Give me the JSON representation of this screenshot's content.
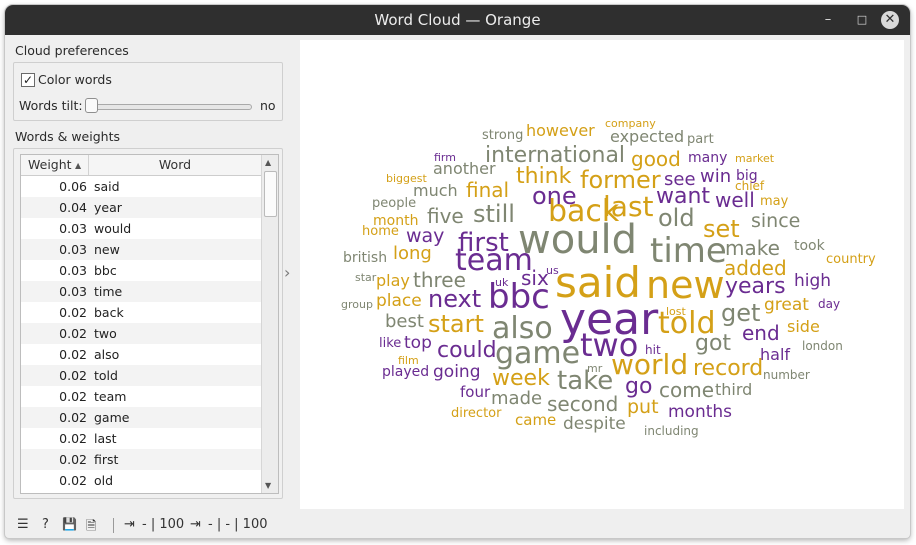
{
  "window": {
    "title": "Word Cloud — Orange",
    "minimize": "–",
    "maximize": "□",
    "close": "✕"
  },
  "preferences": {
    "title": "Cloud preferences",
    "color_words_label": "Color words",
    "color_words_checked": true,
    "check_glyph": "✓",
    "words_tilt_label": "Words tilt:",
    "words_tilt_value": "no",
    "words_tilt_level": 0
  },
  "weights": {
    "title": "Words & weights",
    "columns": [
      "Weight",
      "Word"
    ],
    "sort_indicator": "▲",
    "scroll_up": "▲",
    "scroll_down": "▼",
    "rows": [
      {
        "weight": "0.06",
        "word": "said"
      },
      {
        "weight": "0.04",
        "word": "year"
      },
      {
        "weight": "0.03",
        "word": "would"
      },
      {
        "weight": "0.03",
        "word": "new"
      },
      {
        "weight": "0.03",
        "word": "bbc"
      },
      {
        "weight": "0.03",
        "word": "time"
      },
      {
        "weight": "0.02",
        "word": "back"
      },
      {
        "weight": "0.02",
        "word": "two"
      },
      {
        "weight": "0.02",
        "word": "also"
      },
      {
        "weight": "0.02",
        "word": "told"
      },
      {
        "weight": "0.02",
        "word": "team"
      },
      {
        "weight": "0.02",
        "word": "game"
      },
      {
        "weight": "0.02",
        "word": "last"
      },
      {
        "weight": "0.02",
        "word": "first"
      },
      {
        "weight": "0.02",
        "word": "old"
      }
    ]
  },
  "splitter_glyph": "›",
  "colors": {
    "purple": "#6a2c91",
    "gold": "#d4a017",
    "gray": "#7f8672"
  },
  "cloud_words": [
    {
      "text": "company",
      "color": "gold",
      "size": 11
    },
    {
      "text": "strong",
      "color": "gray",
      "size": 13
    },
    {
      "text": "however",
      "color": "gold",
      "size": 16
    },
    {
      "text": "expected",
      "color": "gray",
      "size": 16
    },
    {
      "text": "part",
      "color": "gray",
      "size": 13
    },
    {
      "text": "firm",
      "color": "purple",
      "size": 11
    },
    {
      "text": "international",
      "color": "gray",
      "size": 22
    },
    {
      "text": "good",
      "color": "gold",
      "size": 20
    },
    {
      "text": "many",
      "color": "purple",
      "size": 14
    },
    {
      "text": "market",
      "color": "gold",
      "size": 11
    },
    {
      "text": "another",
      "color": "gray",
      "size": 16
    },
    {
      "text": "biggest",
      "color": "gold",
      "size": 11
    },
    {
      "text": "think",
      "color": "gold",
      "size": 22
    },
    {
      "text": "former",
      "color": "gold",
      "size": 24
    },
    {
      "text": "see",
      "color": "purple",
      "size": 18
    },
    {
      "text": "win",
      "color": "purple",
      "size": 18
    },
    {
      "text": "big",
      "color": "purple",
      "size": 14
    },
    {
      "text": "much",
      "color": "gray",
      "size": 16
    },
    {
      "text": "final",
      "color": "gold",
      "size": 20
    },
    {
      "text": "one",
      "color": "purple",
      "size": 24
    },
    {
      "text": "want",
      "color": "purple",
      "size": 22
    },
    {
      "text": "chief",
      "color": "gold",
      "size": 12
    },
    {
      "text": "people",
      "color": "gray",
      "size": 13
    },
    {
      "text": "back",
      "color": "gold",
      "size": 30
    },
    {
      "text": "last",
      "color": "gold",
      "size": 28
    },
    {
      "text": "well",
      "color": "purple",
      "size": 20
    },
    {
      "text": "may",
      "color": "gold",
      "size": 13
    },
    {
      "text": "month",
      "color": "gold",
      "size": 14
    },
    {
      "text": "five",
      "color": "gray",
      "size": 20
    },
    {
      "text": "still",
      "color": "gray",
      "size": 24
    },
    {
      "text": "old",
      "color": "gray",
      "size": 24
    },
    {
      "text": "since",
      "color": "gray",
      "size": 19
    },
    {
      "text": "home",
      "color": "gold",
      "size": 13
    },
    {
      "text": "set",
      "color": "gold",
      "size": 24
    },
    {
      "text": "way",
      "color": "purple",
      "size": 19
    },
    {
      "text": "would",
      "color": "gray",
      "size": 40
    },
    {
      "text": "first",
      "color": "purple",
      "size": 26
    },
    {
      "text": "time",
      "color": "gray",
      "size": 34
    },
    {
      "text": "make",
      "color": "gray",
      "size": 20
    },
    {
      "text": "took",
      "color": "gray",
      "size": 14
    },
    {
      "text": "british",
      "color": "gray",
      "size": 14
    },
    {
      "text": "long",
      "color": "gold",
      "size": 18
    },
    {
      "text": "team",
      "color": "purple",
      "size": 30
    },
    {
      "text": "country",
      "color": "gold",
      "size": 13
    },
    {
      "text": "us",
      "color": "purple",
      "size": 11
    },
    {
      "text": "added",
      "color": "gold",
      "size": 20
    },
    {
      "text": "star",
      "color": "gray",
      "size": 11
    },
    {
      "text": "play",
      "color": "gold",
      "size": 16
    },
    {
      "text": "three",
      "color": "gray",
      "size": 20
    },
    {
      "text": "uk",
      "color": "purple",
      "size": 11
    },
    {
      "text": "six",
      "color": "purple",
      "size": 20
    },
    {
      "text": "said",
      "color": "gold",
      "size": 42
    },
    {
      "text": "new",
      "color": "gold",
      "size": 38
    },
    {
      "text": "years",
      "color": "purple",
      "size": 22
    },
    {
      "text": "high",
      "color": "purple",
      "size": 17
    },
    {
      "text": "next",
      "color": "purple",
      "size": 24
    },
    {
      "text": "bbc",
      "color": "purple",
      "size": 34
    },
    {
      "text": "group",
      "color": "gray",
      "size": 11
    },
    {
      "text": "place",
      "color": "gold",
      "size": 17
    },
    {
      "text": "great",
      "color": "gold",
      "size": 17
    },
    {
      "text": "day",
      "color": "purple",
      "size": 12
    },
    {
      "text": "lost",
      "color": "gold",
      "size": 11
    },
    {
      "text": "get",
      "color": "gray",
      "size": 24
    },
    {
      "text": "best",
      "color": "gray",
      "size": 18
    },
    {
      "text": "start",
      "color": "gold",
      "size": 24
    },
    {
      "text": "year",
      "color": "purple",
      "size": 44
    },
    {
      "text": "told",
      "color": "gold",
      "size": 30
    },
    {
      "text": "side",
      "color": "gold",
      "size": 16
    },
    {
      "text": "also",
      "color": "gray",
      "size": 30
    },
    {
      "text": "end",
      "color": "purple",
      "size": 20
    },
    {
      "text": "like",
      "color": "purple",
      "size": 13
    },
    {
      "text": "top",
      "color": "purple",
      "size": 17
    },
    {
      "text": "could",
      "color": "purple",
      "size": 22
    },
    {
      "text": "two",
      "color": "purple",
      "size": 32
    },
    {
      "text": "london",
      "color": "gray",
      "size": 12
    },
    {
      "text": "hit",
      "color": "purple",
      "size": 12
    },
    {
      "text": "got",
      "color": "gray",
      "size": 22
    },
    {
      "text": "half",
      "color": "purple",
      "size": 16
    },
    {
      "text": "game",
      "color": "gray",
      "size": 30
    },
    {
      "text": "film",
      "color": "gold",
      "size": 11
    },
    {
      "text": "going",
      "color": "purple",
      "size": 17
    },
    {
      "text": "mr",
      "color": "gray",
      "size": 11
    },
    {
      "text": "world",
      "color": "gold",
      "size": 28
    },
    {
      "text": "record",
      "color": "gold",
      "size": 22
    },
    {
      "text": "played",
      "color": "purple",
      "size": 14
    },
    {
      "text": "number",
      "color": "gray",
      "size": 12
    },
    {
      "text": "week",
      "color": "gold",
      "size": 22
    },
    {
      "text": "take",
      "color": "gray",
      "size": 26
    },
    {
      "text": "go",
      "color": "purple",
      "size": 22
    },
    {
      "text": "come",
      "color": "gray",
      "size": 20
    },
    {
      "text": "third",
      "color": "gray",
      "size": 16
    },
    {
      "text": "four",
      "color": "purple",
      "size": 15
    },
    {
      "text": "made",
      "color": "gray",
      "size": 18
    },
    {
      "text": "second",
      "color": "gray",
      "size": 20
    },
    {
      "text": "put",
      "color": "gold",
      "size": 19
    },
    {
      "text": "months",
      "color": "purple",
      "size": 17
    },
    {
      "text": "director",
      "color": "gold",
      "size": 13
    },
    {
      "text": "came",
      "color": "gold",
      "size": 15
    },
    {
      "text": "despite",
      "color": "gray",
      "size": 17
    },
    {
      "text": "including",
      "color": "gray",
      "size": 12
    }
  ],
  "statusbar": {
    "menu_icon": "☰",
    "help_icon": "?",
    "save_icon": "💾",
    "report_icon": "🗎",
    "input_icon": "⇥",
    "input_text": "- | 100",
    "output_icon": "⇥",
    "output_text": "- | - | 100"
  }
}
